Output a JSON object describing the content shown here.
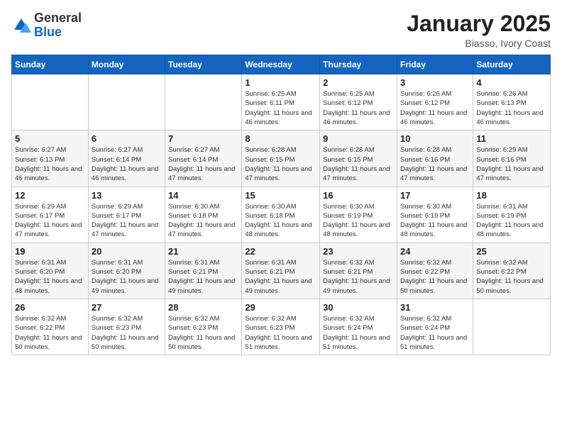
{
  "header": {
    "logo_general": "General",
    "logo_blue": "Blue",
    "month": "January 2025",
    "location": "Biasso, Ivory Coast"
  },
  "weekdays": [
    "Sunday",
    "Monday",
    "Tuesday",
    "Wednesday",
    "Thursday",
    "Friday",
    "Saturday"
  ],
  "weeks": [
    [
      {
        "day": "",
        "info": ""
      },
      {
        "day": "",
        "info": ""
      },
      {
        "day": "",
        "info": ""
      },
      {
        "day": "1",
        "info": "Sunrise: 6:25 AM\nSunset: 6:11 PM\nDaylight: 11 hours\nand 46 minutes."
      },
      {
        "day": "2",
        "info": "Sunrise: 6:25 AM\nSunset: 6:12 PM\nDaylight: 11 hours\nand 46 minutes."
      },
      {
        "day": "3",
        "info": "Sunrise: 6:26 AM\nSunset: 6:12 PM\nDaylight: 11 hours\nand 46 minutes."
      },
      {
        "day": "4",
        "info": "Sunrise: 6:26 AM\nSunset: 6:13 PM\nDaylight: 11 hours\nand 46 minutes."
      }
    ],
    [
      {
        "day": "5",
        "info": "Sunrise: 6:27 AM\nSunset: 6:13 PM\nDaylight: 11 hours\nand 46 minutes."
      },
      {
        "day": "6",
        "info": "Sunrise: 6:27 AM\nSunset: 6:14 PM\nDaylight: 11 hours\nand 46 minutes."
      },
      {
        "day": "7",
        "info": "Sunrise: 6:27 AM\nSunset: 6:14 PM\nDaylight: 11 hours\nand 47 minutes."
      },
      {
        "day": "8",
        "info": "Sunrise: 6:28 AM\nSunset: 6:15 PM\nDaylight: 11 hours\nand 47 minutes."
      },
      {
        "day": "9",
        "info": "Sunrise: 6:28 AM\nSunset: 6:15 PM\nDaylight: 11 hours\nand 47 minutes."
      },
      {
        "day": "10",
        "info": "Sunrise: 6:28 AM\nSunset: 6:16 PM\nDaylight: 11 hours\nand 47 minutes."
      },
      {
        "day": "11",
        "info": "Sunrise: 6:29 AM\nSunset: 6:16 PM\nDaylight: 11 hours\nand 47 minutes."
      }
    ],
    [
      {
        "day": "12",
        "info": "Sunrise: 6:29 AM\nSunset: 6:17 PM\nDaylight: 11 hours\nand 47 minutes."
      },
      {
        "day": "13",
        "info": "Sunrise: 6:29 AM\nSunset: 6:17 PM\nDaylight: 11 hours\nand 47 minutes."
      },
      {
        "day": "14",
        "info": "Sunrise: 6:30 AM\nSunset: 6:18 PM\nDaylight: 11 hours\nand 47 minutes."
      },
      {
        "day": "15",
        "info": "Sunrise: 6:30 AM\nSunset: 6:18 PM\nDaylight: 11 hours\nand 48 minutes."
      },
      {
        "day": "16",
        "info": "Sunrise: 6:30 AM\nSunset: 6:19 PM\nDaylight: 11 hours\nand 48 minutes."
      },
      {
        "day": "17",
        "info": "Sunrise: 6:30 AM\nSunset: 6:19 PM\nDaylight: 11 hours\nand 48 minutes."
      },
      {
        "day": "18",
        "info": "Sunrise: 6:31 AM\nSunset: 6:19 PM\nDaylight: 11 hours\nand 48 minutes."
      }
    ],
    [
      {
        "day": "19",
        "info": "Sunrise: 6:31 AM\nSunset: 6:20 PM\nDaylight: 11 hours\nand 48 minutes."
      },
      {
        "day": "20",
        "info": "Sunrise: 6:31 AM\nSunset: 6:20 PM\nDaylight: 11 hours\nand 49 minutes."
      },
      {
        "day": "21",
        "info": "Sunrise: 6:31 AM\nSunset: 6:21 PM\nDaylight: 11 hours\nand 49 minutes."
      },
      {
        "day": "22",
        "info": "Sunrise: 6:31 AM\nSunset: 6:21 PM\nDaylight: 11 hours\nand 49 minutes."
      },
      {
        "day": "23",
        "info": "Sunrise: 6:32 AM\nSunset: 6:21 PM\nDaylight: 11 hours\nand 49 minutes."
      },
      {
        "day": "24",
        "info": "Sunrise: 6:32 AM\nSunset: 6:22 PM\nDaylight: 11 hours\nand 50 minutes."
      },
      {
        "day": "25",
        "info": "Sunrise: 6:32 AM\nSunset: 6:22 PM\nDaylight: 11 hours\nand 50 minutes."
      }
    ],
    [
      {
        "day": "26",
        "info": "Sunrise: 6:32 AM\nSunset: 6:22 PM\nDaylight: 11 hours\nand 50 minutes."
      },
      {
        "day": "27",
        "info": "Sunrise: 6:32 AM\nSunset: 6:23 PM\nDaylight: 11 hours\nand 50 minutes."
      },
      {
        "day": "28",
        "info": "Sunrise: 6:32 AM\nSunset: 6:23 PM\nDaylight: 11 hours\nand 50 minutes."
      },
      {
        "day": "29",
        "info": "Sunrise: 6:32 AM\nSunset: 6:23 PM\nDaylight: 11 hours\nand 51 minutes."
      },
      {
        "day": "30",
        "info": "Sunrise: 6:32 AM\nSunset: 6:24 PM\nDaylight: 11 hours\nand 51 minutes."
      },
      {
        "day": "31",
        "info": "Sunrise: 6:32 AM\nSunset: 6:24 PM\nDaylight: 11 hours\nand 51 minutes."
      },
      {
        "day": "",
        "info": ""
      }
    ]
  ]
}
